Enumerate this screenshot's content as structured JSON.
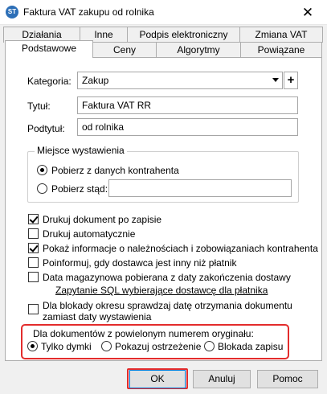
{
  "window": {
    "title": "Faktura VAT zakupu od rolnika",
    "close_glyph": "✕",
    "app_icon_text": "ST"
  },
  "tabs_row1": [
    "Działania",
    "Inne",
    "Podpis elektroniczny",
    "Zmiana VAT"
  ],
  "tabs_row2": [
    "Podstawowe",
    "Ceny",
    "Algorytmy",
    "Powiązane"
  ],
  "active_tab": "Podstawowe",
  "form": {
    "kategoria_label": "Kategoria:",
    "kategoria_value": "Zakup",
    "plus_glyph": "+",
    "tytul_label": "Tytuł:",
    "tytul_value": "Faktura VAT RR",
    "podtytul_label": "Podtytuł:",
    "podtytul_value": "od rolnika"
  },
  "miejsce": {
    "title": "Miejsce wystawienia",
    "option1": "Pobierz z danych kontrahenta",
    "option2": "Pobierz stąd:",
    "option2_value": "",
    "selected": 1
  },
  "checkboxes": [
    {
      "label": "Drukuj dokument po zapisie",
      "checked": true
    },
    {
      "label": "Drukuj automatycznie",
      "checked": false
    },
    {
      "label": "Pokaż informacje o należnościach i zobowiązaniach kontrahenta",
      "checked": true
    },
    {
      "label": "Poinformuj, gdy dostawca jest inny niż płatnik",
      "checked": false
    },
    {
      "label": "Data magazynowa pobierana z daty zakończenia dostawy",
      "checked": false
    }
  ],
  "sql_link": "Zapytanie SQL wybierające dostawcę dla płatnika",
  "blokada_check": {
    "line1": "Dla blokady okresu sprawdzaj datę otrzymania dokumentu",
    "line2": "zamiast daty wystawienia",
    "checked": false
  },
  "duplicates": {
    "title": "Dla dokumentów z powielonym numerem oryginału:",
    "options": [
      "Tylko dymki",
      "Pokazuj ostrzeżenie",
      "Blokada zapisu"
    ],
    "selected": 0
  },
  "buttons": {
    "ok": "OK",
    "cancel": "Anuluj",
    "help": "Pomoc"
  },
  "colors": {
    "highlight": "#e32c2c",
    "default_button_border": "#0078d7",
    "app_icon": "#2d6fb7"
  }
}
